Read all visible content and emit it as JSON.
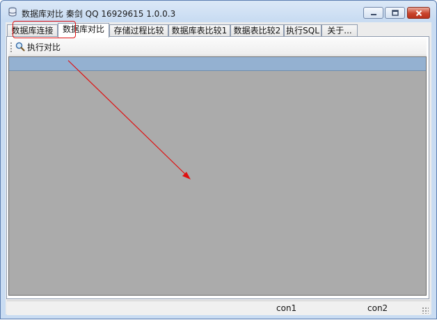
{
  "window": {
    "title": "数据库对比 秦剑 QQ 16929615 1.0.0.3",
    "icon": "database-app-icon",
    "controls": {
      "minimize": "minimize-icon",
      "maximize": "maximize-icon",
      "close": "close-icon"
    }
  },
  "tabs": [
    {
      "label": "数据库连接",
      "active": false
    },
    {
      "label": "数据库对比",
      "active": true
    },
    {
      "label": "存储过程比较",
      "active": false
    },
    {
      "label": "数据库表比较1",
      "active": false
    },
    {
      "label": "数据表比较2",
      "active": false
    },
    {
      "label": "执行SQL",
      "active": false
    },
    {
      "label": "关于...",
      "active": false
    }
  ],
  "toolbar": {
    "run_compare": {
      "label": "执行对比",
      "icon": "magnifier-icon"
    }
  },
  "statusbar": {
    "panel1": "",
    "con1": "con1",
    "con2": "con2"
  },
  "colors": {
    "annotation": "#e01010",
    "grid_background": "#ababab",
    "grid_header": "#94b1d1",
    "close_button": "#c9442c"
  }
}
